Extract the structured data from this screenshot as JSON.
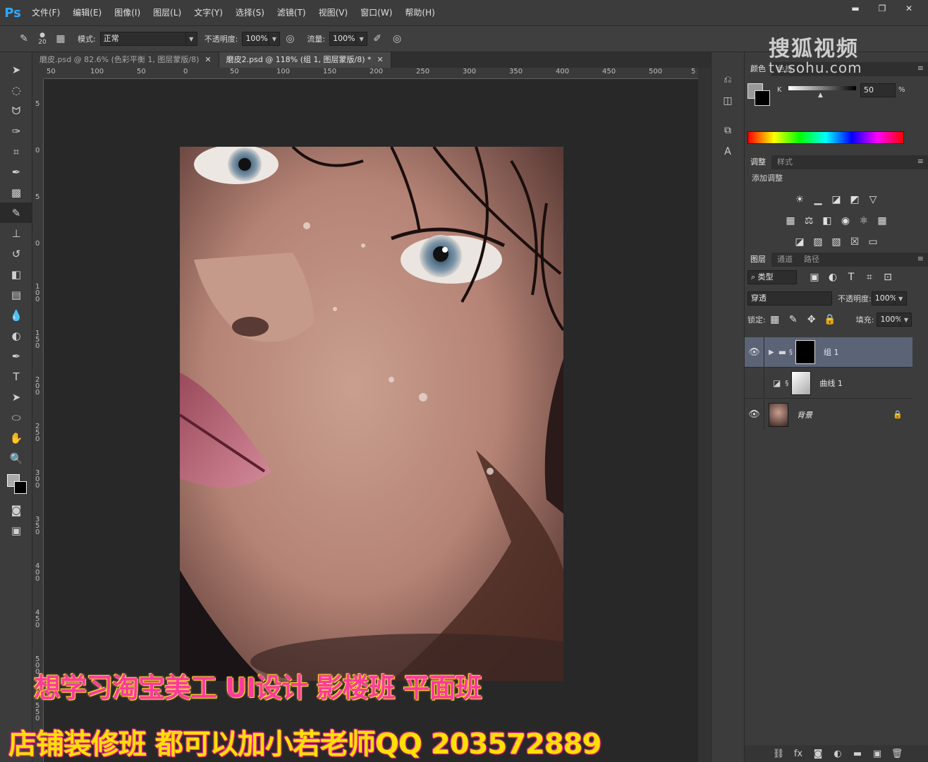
{
  "app": {
    "logo": "Ps"
  },
  "menu": [
    "文件(F)",
    "编辑(E)",
    "图像(I)",
    "图层(L)",
    "文字(Y)",
    "选择(S)",
    "滤镜(T)",
    "视图(V)",
    "窗口(W)",
    "帮助(H)"
  ],
  "window_controls": {
    "minimize": "▬",
    "maximize": "❐",
    "close": "✕"
  },
  "options": {
    "brush_size": "20",
    "mode_label": "模式:",
    "mode_value": "正常",
    "opacity_label": "不透明度:",
    "opacity_value": "100%",
    "flow_label": "流量:",
    "flow_value": "100%"
  },
  "tabs": [
    {
      "label": "磨皮.psd @ 82.6% (色彩平衡 1, 图层蒙版/8)",
      "close": "✕",
      "active": false
    },
    {
      "label": "磨皮2.psd @ 118% (组 1, 图层蒙版/8) *",
      "close": "✕",
      "active": true
    }
  ],
  "ruler_h": [
    "50",
    "100",
    "50",
    "0",
    "50",
    "100",
    "150",
    "200",
    "250",
    "300",
    "350",
    "400",
    "450",
    "500",
    "5"
  ],
  "ruler_v": [
    "5",
    "0",
    "5",
    "0",
    "1 0 0",
    "1 5 0",
    "2 0 0",
    "2 5 0",
    "3 0 0",
    "3 5 0",
    "4 0 0",
    "4 5 0",
    "5 0 0",
    "5 5 0"
  ],
  "tools": [
    "move-icon",
    "marquee-icon",
    "lasso-icon",
    "quick-select-icon",
    "crop-icon",
    "eyedropper-icon",
    "healing-icon",
    "brush-icon",
    "stamp-icon",
    "history-brush-icon",
    "eraser-icon",
    "gradient-icon",
    "blur-icon",
    "dodge-icon",
    "pen-icon",
    "type-icon",
    "path-select-icon",
    "shape-icon",
    "hand-icon",
    "zoom-icon"
  ],
  "promo": {
    "line1": "想学习淘宝美工   UI设计  影楼班  平面班",
    "line2": "店铺装修班  都可以加小若老师QQ 203572889"
  },
  "watermark": {
    "main": "搜狐视频",
    "url": "tv.sohu.com"
  },
  "color_panel": {
    "tabs": [
      "颜色",
      "色板"
    ],
    "channel_label": "K",
    "value": "50",
    "unit": "%"
  },
  "adjustments": {
    "tabs": [
      "调整",
      "样式"
    ],
    "title": "添加调整"
  },
  "layers": {
    "tabs": [
      "图层",
      "通道",
      "路径"
    ],
    "filter_label": "类型",
    "blend_mode": "穿透",
    "opacity_label": "不透明度:",
    "opacity_value": "100%",
    "lock_label": "锁定:",
    "fill_label": "填充:",
    "fill_value": "100%",
    "items": [
      {
        "name": "组 1",
        "visible": true,
        "selected": true
      },
      {
        "name": "曲线 1",
        "visible": false,
        "selected": false
      },
      {
        "name": "背景",
        "visible": true,
        "selected": false
      }
    ]
  },
  "colors": {
    "accent": "#31a8ff",
    "selected_layer": "#5b6377",
    "promo_pink": "#ff3a9c",
    "promo_yellow": "#ffe100"
  }
}
